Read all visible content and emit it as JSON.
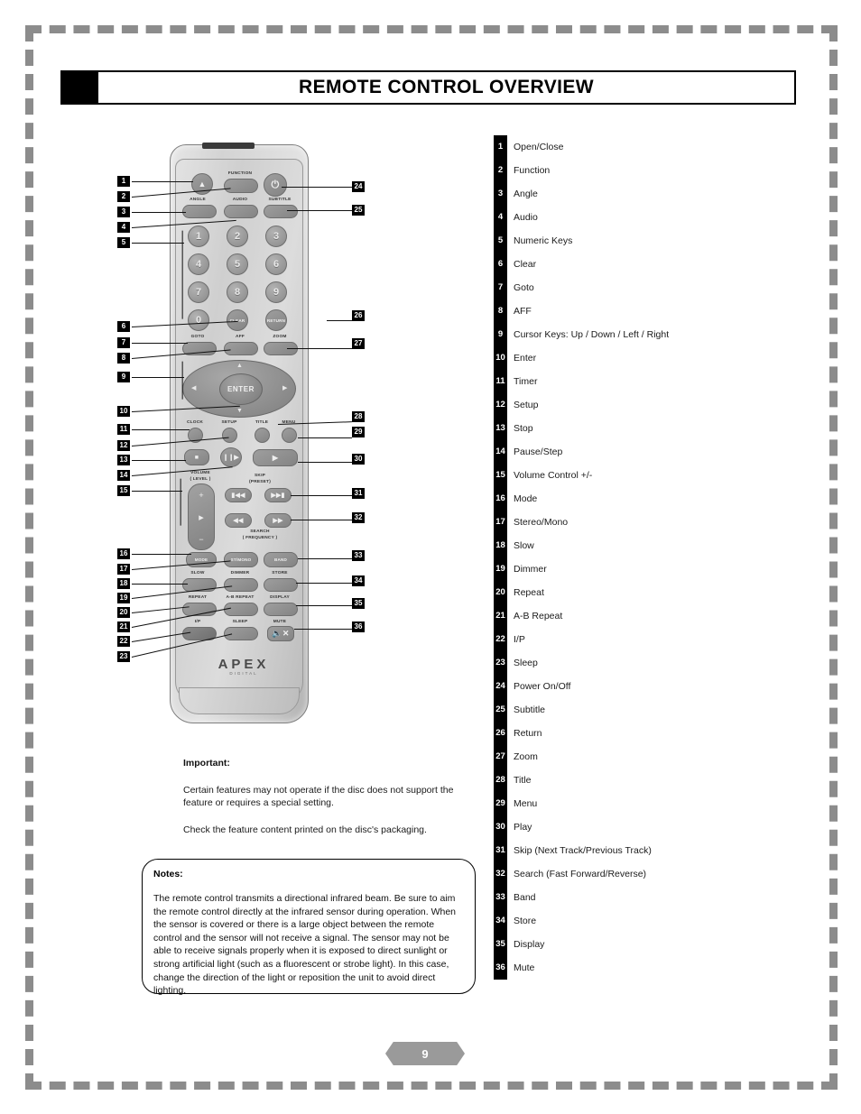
{
  "header": {
    "title": "REMOTE CONTROL OVERVIEW"
  },
  "colors": {
    "border_dash": "#8c8c8c",
    "legend_bar": "#000000",
    "page_banner": "#9a9a9a",
    "remote_body": "#d3d3d3",
    "button": "#8f8f8f"
  },
  "legend": {
    "items": [
      {
        "num": "1",
        "label": "Open/Close"
      },
      {
        "num": "2",
        "label": "Function"
      },
      {
        "num": "3",
        "label": "Angle"
      },
      {
        "num": "4",
        "label": "Audio"
      },
      {
        "num": "5",
        "label": "Numeric Keys"
      },
      {
        "num": "6",
        "label": "Clear"
      },
      {
        "num": "7",
        "label": "Goto"
      },
      {
        "num": "8",
        "label": "AFF"
      },
      {
        "num": "9",
        "label": "Cursor Keys: Up / Down / Left / Right"
      },
      {
        "num": "10",
        "label": "Enter"
      },
      {
        "num": "11",
        "label": "Timer"
      },
      {
        "num": "12",
        "label": "Setup"
      },
      {
        "num": "13",
        "label": "Stop"
      },
      {
        "num": "14",
        "label": "Pause/Step"
      },
      {
        "num": "15",
        "label": "Volume Control +/-"
      },
      {
        "num": "16",
        "label": "Mode"
      },
      {
        "num": "17",
        "label": "Stereo/Mono"
      },
      {
        "num": "18",
        "label": "Slow"
      },
      {
        "num": "19",
        "label": "Dimmer"
      },
      {
        "num": "20",
        "label": "Repeat"
      },
      {
        "num": "21",
        "label": "A-B Repeat"
      },
      {
        "num": "22",
        "label": "I/P"
      },
      {
        "num": "23",
        "label": "Sleep"
      },
      {
        "num": "24",
        "label": "Power On/Off"
      },
      {
        "num": "25",
        "label": "Subtitle"
      },
      {
        "num": "26",
        "label": "Return"
      },
      {
        "num": "27",
        "label": "Zoom"
      },
      {
        "num": "28",
        "label": "Title"
      },
      {
        "num": "29",
        "label": "Menu"
      },
      {
        "num": "30",
        "label": "Play"
      },
      {
        "num": "31",
        "label": "Skip (Next Track/Previous Track)"
      },
      {
        "num": "32",
        "label": "Search (Fast Forward/Reverse)"
      },
      {
        "num": "33",
        "label": "Band"
      },
      {
        "num": "34",
        "label": "Store"
      },
      {
        "num": "35",
        "label": "Display"
      },
      {
        "num": "36",
        "label": "Mute"
      }
    ]
  },
  "remote": {
    "brand": "APEX",
    "brand_sub": "DIGITAL",
    "enter_label": "ENTER",
    "labels": {
      "function": "FUNCTION",
      "angle": "ANGLE",
      "audio": "AUDIO",
      "subtitle": "SUBTITLE",
      "clear": "CLEAR",
      "return": "RETURN",
      "goto": "GOTO",
      "aff": "AFF",
      "zoom": "ZOOM",
      "clock": "CLOCK",
      "setup": "SETUP",
      "title": "TITLE",
      "menu": "MENU",
      "volume": "VOLUME",
      "volume_sub": "( LEVEL )",
      "skip": "SKIP",
      "skip_sub": "(PRESET)",
      "search": "SEARCH",
      "search_sub": "( FREQUENCY )",
      "mode": "MODE",
      "stmono": "ST/MONO",
      "band": "BAND",
      "slow": "SLOW",
      "dimmer": "DIMMER",
      "store": "STORE",
      "repeat": "REPEAT",
      "ab_repeat": "A-B REPEAT",
      "display": "DISPLAY",
      "ip": "I/P",
      "sleep": "SLEEP",
      "mute": "MUTE"
    },
    "numeric_keys": [
      "1",
      "2",
      "3",
      "4",
      "5",
      "6",
      "7",
      "8",
      "9",
      "0"
    ],
    "callouts_left": [
      "1",
      "2",
      "3",
      "4",
      "5",
      "6",
      "7",
      "8",
      "9",
      "10",
      "11",
      "12",
      "13",
      "14",
      "15",
      "16",
      "17",
      "18",
      "19",
      "20",
      "21",
      "22",
      "23"
    ],
    "callouts_right": [
      "24",
      "25",
      "26",
      "27",
      "28",
      "29",
      "30",
      "31",
      "32",
      "33",
      "34",
      "35",
      "36"
    ]
  },
  "important": {
    "title": "Important:",
    "para1": "Certain features may not operate if the disc does not support the feature or requires a special setting.",
    "para2": "Check the feature content printed on the disc's packaging."
  },
  "notes": {
    "title": "Notes:",
    "body": "The remote control transmits a directional infrared beam. Be sure to aim the remote control directly at the infrared sensor during operation. When the sensor is covered or there is a large object between the remote control and the sensor  will not receive a signal. The sensor may not be able to receive signals properly when it is exposed to direct sunlight or strong artificial light (such as a fluorescent or strobe light). In this case, change the direction of the light or reposition the unit to avoid direct lighting."
  },
  "footer": {
    "page_number": "9"
  }
}
